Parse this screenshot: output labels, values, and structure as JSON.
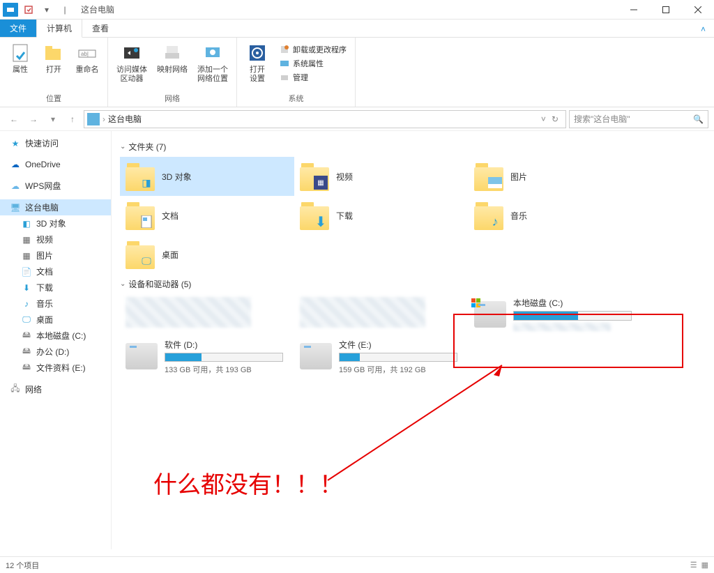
{
  "titlebar": {
    "title": "这台电脑"
  },
  "tabs": {
    "file": "文件",
    "computer": "计算机",
    "view": "查看"
  },
  "ribbon": {
    "group1": {
      "label": "位置",
      "properties": "属性",
      "open": "打开",
      "rename": "重命名"
    },
    "group2": {
      "label": "网络",
      "media": "访问媒体",
      "media2": "区动器",
      "mapdrive": "映射网络",
      "addloc": "添加一个",
      "addloc2": "网络位置"
    },
    "group3": {
      "label": "系统",
      "opensettings": "打开",
      "opensettings2": "设置",
      "uninstall": "卸载或更改程序",
      "sysprops": "系统属性",
      "manage": "管理"
    }
  },
  "nav": {
    "location": "这台电脑"
  },
  "search": {
    "placeholder": "搜索\"这台电脑\""
  },
  "sidebar": {
    "quick": "快速访问",
    "onedrive": "OneDrive",
    "wps": "WPS网盘",
    "thispc": "这台电脑",
    "objects3d": "3D 对象",
    "videos": "视频",
    "pictures": "图片",
    "documents": "文档",
    "downloads": "下载",
    "music": "音乐",
    "desktop": "桌面",
    "localc": "本地磁盘 (C:)",
    "office": "办公 (D:)",
    "files": "文件资料 (E:)",
    "network": "网络"
  },
  "sections": {
    "folders_header": "文件夹 (7)",
    "drives_header": "设备和驱动器 (5)"
  },
  "folders": {
    "objects3d": "3D 对象",
    "videos": "视频",
    "pictures": "图片",
    "documents": "文档",
    "downloads": "下载",
    "music": "音乐",
    "desktop": "桌面"
  },
  "drives": {
    "localc": {
      "name": "本地磁盘 (C:)"
    },
    "software": {
      "name": "软件 (D:)",
      "text": "133 GB 可用，共 193 GB",
      "fill": 31
    },
    "files": {
      "name": "文件 (E:)",
      "text": "159 GB 可用，共 192 GB",
      "fill": 17
    }
  },
  "annotation": {
    "text": "什么都没有！！！"
  },
  "status": {
    "items": "12 个项目"
  }
}
